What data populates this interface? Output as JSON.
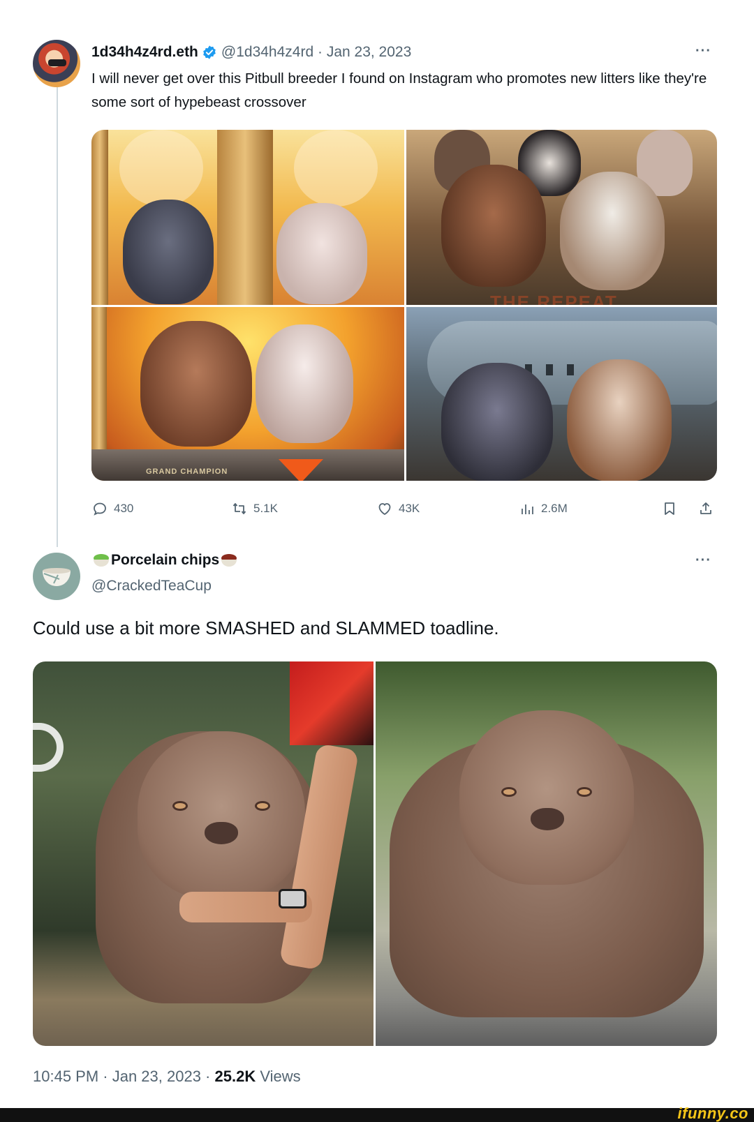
{
  "tweet": {
    "display_name": "1d34h4z4rd.eth",
    "handle": "@1d34h4z4rd",
    "separator": "·",
    "date": "Jan 23, 2023",
    "more": "···",
    "text": "I will never get over this Pitbull breeder I found on Instagram who promotes new litters like they're some sort of hypebeast crossover",
    "image_overlays": {
      "repeat_text": "THE REPEAT",
      "champion_text": "GRAND CHAMPION"
    },
    "actions": {
      "replies": "430",
      "retweets": "5.1K",
      "likes": "43K",
      "views": "2.6M"
    },
    "colors": {
      "verified": "#1d9bf0",
      "secondary_text": "#536471"
    }
  },
  "reply": {
    "display_name": "Porcelain chips",
    "handle": "@CrackedTeaCup",
    "more": "···",
    "text": "Could use a bit more SMASHED and SLAMMED toadline.",
    "timestamp": "10:45 PM · Jan 23, 2023 · ",
    "views_count": "25.2K",
    "views_label": " Views"
  },
  "watermark": {
    "text": "ifunny.co",
    "color": "#f5c518"
  }
}
